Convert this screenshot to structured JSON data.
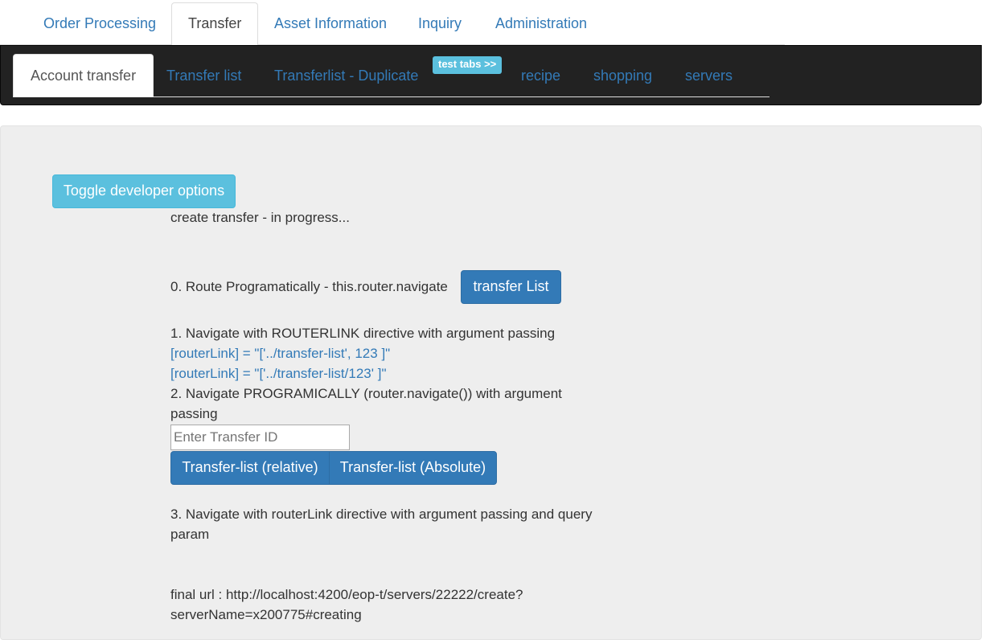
{
  "top_nav": {
    "tabs": [
      "Order Processing",
      "Transfer",
      "Asset Information",
      "Inquiry",
      "Administration"
    ],
    "active": "Transfer"
  },
  "sub_nav": {
    "tabs": [
      "Account transfer",
      "Transfer list",
      "Transferlist - Duplicate",
      "recipe",
      "shopping",
      "servers"
    ],
    "active": "Account transfer",
    "badge": "test tabs >>"
  },
  "content": {
    "toggle_button": "Toggle developer options",
    "status": "create transfer - in progress...",
    "section0_label": "0. Route Programatically - this.router.navigate",
    "section0_button": "transfer List",
    "section1_label": "1. Navigate with ROUTERLINK directive with argument passing",
    "link1": "[routerLink] = \"['../transfer-list', 123 ]\"",
    "link2": "[routerLink] = \"['../transfer-list/123' ]\"",
    "section2_label_line1": "2. Navigate PROGRAMICALLY (router.navigate()) with argument",
    "section2_label_line2": "passing",
    "transfer_id_placeholder": "Enter Transfer ID",
    "transfer_id_value": "",
    "btn_relative": "Transfer-list (relative)",
    "btn_absolute": "Transfer-list (Absolute)",
    "section3_label_line1": "3. Navigate with routerLink directive with argument passing and query",
    "section3_label_line2": "param",
    "final_url_line1": "final url : http://localhost:4200/eop-t/servers/22222/create?",
    "final_url_line2": "serverName=x200775#creating"
  },
  "colors": {
    "link": "#337ab7",
    "primary_button": "#337ab7",
    "info_button": "#5bc0de",
    "navbar": "#222222",
    "well": "#eeeeee"
  }
}
